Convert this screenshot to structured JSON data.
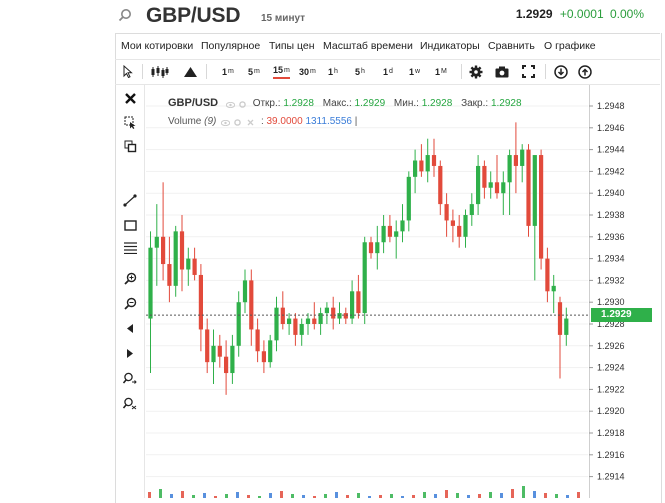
{
  "header": {
    "symbol": "GBP/USD",
    "timeframe": "15 минут",
    "price": "1.2929",
    "change": "+0.0001",
    "change_pct": "0.00%"
  },
  "menu": [
    "Мои котировки",
    "Популярное",
    "Типы цен",
    "Масштаб времени",
    "Индикаторы",
    "Сравнить",
    "О графике"
  ],
  "toolbar": {
    "timeframes": [
      {
        "n": "1",
        "u": "m"
      },
      {
        "n": "5",
        "u": "m"
      },
      {
        "n": "15",
        "u": "m"
      },
      {
        "n": "30",
        "u": "m"
      },
      {
        "n": "1",
        "u": "h"
      },
      {
        "n": "5",
        "u": "h"
      },
      {
        "n": "1",
        "u": "d"
      },
      {
        "n": "1",
        "u": "w"
      },
      {
        "n": "1",
        "u": "M"
      }
    ],
    "active_index": 2
  },
  "legend": {
    "symbol": "GBP/USD",
    "open_label": "Откр.:",
    "open": "1.2928",
    "high_label": "Макс.:",
    "high": "1.2929",
    "low_label": "Мин.:",
    "low": "1.2928",
    "close_label": "Закр.:",
    "close": "1.2928",
    "volume_label": "Volume",
    "volume_param": "(9)",
    "volume_v1": "39.0000",
    "volume_v2": "1311.5556"
  },
  "colors": {
    "up": "#2fb04a",
    "down": "#e24a3b",
    "accent": "#e24a3b",
    "volume": "#3b7dd8"
  },
  "chart_data": {
    "type": "candlestick",
    "y_ticks": [
      "1.2948",
      "1.2946",
      "1.2944",
      "1.2942",
      "1.2940",
      "1.2938",
      "1.2936",
      "1.2934",
      "1.2932",
      "1.2930",
      "1.2928",
      "1.2926",
      "1.2924",
      "1.2922",
      "1.2920",
      "1.2918",
      "1.2916",
      "1.2914"
    ],
    "ylim": [
      1.2913,
      1.2949
    ],
    "last_price": "1.2929",
    "candles": [
      {
        "o": 1.29285,
        "h": 1.29365,
        "l": 1.29235,
        "c": 1.2935
      },
      {
        "o": 1.2935,
        "h": 1.2939,
        "l": 1.29315,
        "c": 1.2936
      },
      {
        "o": 1.2936,
        "h": 1.2941,
        "l": 1.2932,
        "c": 1.29335
      },
      {
        "o": 1.29335,
        "h": 1.2936,
        "l": 1.293,
        "c": 1.29315
      },
      {
        "o": 1.29315,
        "h": 1.2937,
        "l": 1.29305,
        "c": 1.29365
      },
      {
        "o": 1.29365,
        "h": 1.2938,
        "l": 1.2931,
        "c": 1.2933
      },
      {
        "o": 1.2933,
        "h": 1.2935,
        "l": 1.29315,
        "c": 1.2934
      },
      {
        "o": 1.2934,
        "h": 1.2935,
        "l": 1.2932,
        "c": 1.29325
      },
      {
        "o": 1.29325,
        "h": 1.29335,
        "l": 1.29255,
        "c": 1.29275
      },
      {
        "o": 1.29275,
        "h": 1.29285,
        "l": 1.29235,
        "c": 1.29245
      },
      {
        "o": 1.29245,
        "h": 1.29275,
        "l": 1.29225,
        "c": 1.2926
      },
      {
        "o": 1.2926,
        "h": 1.2927,
        "l": 1.2924,
        "c": 1.2925
      },
      {
        "o": 1.2925,
        "h": 1.29265,
        "l": 1.29215,
        "c": 1.29235
      },
      {
        "o": 1.29235,
        "h": 1.2927,
        "l": 1.29225,
        "c": 1.2926
      },
      {
        "o": 1.2926,
        "h": 1.2931,
        "l": 1.2925,
        "c": 1.293
      },
      {
        "o": 1.293,
        "h": 1.2933,
        "l": 1.2929,
        "c": 1.2932
      },
      {
        "o": 1.2932,
        "h": 1.2933,
        "l": 1.2926,
        "c": 1.29275
      },
      {
        "o": 1.29275,
        "h": 1.29285,
        "l": 1.29245,
        "c": 1.29255
      },
      {
        "o": 1.29255,
        "h": 1.29265,
        "l": 1.29235,
        "c": 1.29245
      },
      {
        "o": 1.29245,
        "h": 1.2927,
        "l": 1.2924,
        "c": 1.29265
      },
      {
        "o": 1.29265,
        "h": 1.29305,
        "l": 1.29255,
        "c": 1.29295
      },
      {
        "o": 1.29295,
        "h": 1.2931,
        "l": 1.29275,
        "c": 1.2928
      },
      {
        "o": 1.2928,
        "h": 1.2929,
        "l": 1.2927,
        "c": 1.29285
      },
      {
        "o": 1.29285,
        "h": 1.2929,
        "l": 1.2926,
        "c": 1.2927
      },
      {
        "o": 1.2927,
        "h": 1.29285,
        "l": 1.2926,
        "c": 1.2928
      },
      {
        "o": 1.2928,
        "h": 1.2929,
        "l": 1.2927,
        "c": 1.29285
      },
      {
        "o": 1.29285,
        "h": 1.293,
        "l": 1.29275,
        "c": 1.2928
      },
      {
        "o": 1.2928,
        "h": 1.29295,
        "l": 1.2927,
        "c": 1.2929
      },
      {
        "o": 1.2929,
        "h": 1.293,
        "l": 1.2928,
        "c": 1.29295
      },
      {
        "o": 1.29295,
        "h": 1.29305,
        "l": 1.29275,
        "c": 1.29285
      },
      {
        "o": 1.29285,
        "h": 1.293,
        "l": 1.2928,
        "c": 1.2929
      },
      {
        "o": 1.2929,
        "h": 1.29295,
        "l": 1.2928,
        "c": 1.29285
      },
      {
        "o": 1.29285,
        "h": 1.2932,
        "l": 1.2928,
        "c": 1.2931
      },
      {
        "o": 1.2931,
        "h": 1.29325,
        "l": 1.29285,
        "c": 1.2929
      },
      {
        "o": 1.2929,
        "h": 1.2936,
        "l": 1.2928,
        "c": 1.29355
      },
      {
        "o": 1.29355,
        "h": 1.2936,
        "l": 1.2934,
        "c": 1.29345
      },
      {
        "o": 1.29345,
        "h": 1.2937,
        "l": 1.2933,
        "c": 1.29355
      },
      {
        "o": 1.29355,
        "h": 1.2938,
        "l": 1.29345,
        "c": 1.2937
      },
      {
        "o": 1.2937,
        "h": 1.2938,
        "l": 1.29355,
        "c": 1.2936
      },
      {
        "o": 1.2936,
        "h": 1.29375,
        "l": 1.2934,
        "c": 1.29365
      },
      {
        "o": 1.29365,
        "h": 1.2939,
        "l": 1.29355,
        "c": 1.29375
      },
      {
        "o": 1.29375,
        "h": 1.2942,
        "l": 1.29365,
        "c": 1.29415
      },
      {
        "o": 1.29415,
        "h": 1.2944,
        "l": 1.294,
        "c": 1.2943
      },
      {
        "o": 1.2943,
        "h": 1.29445,
        "l": 1.29415,
        "c": 1.2942
      },
      {
        "o": 1.2942,
        "h": 1.2945,
        "l": 1.2941,
        "c": 1.29435
      },
      {
        "o": 1.29435,
        "h": 1.2945,
        "l": 1.29415,
        "c": 1.29425
      },
      {
        "o": 1.29425,
        "h": 1.2943,
        "l": 1.2938,
        "c": 1.2939
      },
      {
        "o": 1.2939,
        "h": 1.294,
        "l": 1.2936,
        "c": 1.29375
      },
      {
        "o": 1.29375,
        "h": 1.29385,
        "l": 1.29355,
        "c": 1.2937
      },
      {
        "o": 1.2937,
        "h": 1.2938,
        "l": 1.2935,
        "c": 1.2936
      },
      {
        "o": 1.2936,
        "h": 1.29385,
        "l": 1.2935,
        "c": 1.2938
      },
      {
        "o": 1.2938,
        "h": 1.294,
        "l": 1.2937,
        "c": 1.2939
      },
      {
        "o": 1.2939,
        "h": 1.29435,
        "l": 1.2938,
        "c": 1.29425
      },
      {
        "o": 1.29425,
        "h": 1.2943,
        "l": 1.29395,
        "c": 1.29405
      },
      {
        "o": 1.29405,
        "h": 1.2942,
        "l": 1.29395,
        "c": 1.2941
      },
      {
        "o": 1.2941,
        "h": 1.29435,
        "l": 1.29395,
        "c": 1.294
      },
      {
        "o": 1.294,
        "h": 1.2942,
        "l": 1.2938,
        "c": 1.2941
      },
      {
        "o": 1.2941,
        "h": 1.2944,
        "l": 1.2938,
        "c": 1.29435
      },
      {
        "o": 1.29435,
        "h": 1.29465,
        "l": 1.294,
        "c": 1.29425
      },
      {
        "o": 1.29425,
        "h": 1.29445,
        "l": 1.2941,
        "c": 1.2944
      },
      {
        "o": 1.2944,
        "h": 1.29445,
        "l": 1.2936,
        "c": 1.2937
      },
      {
        "o": 1.2937,
        "h": 1.2939,
        "l": 1.2932,
        "c": 1.29435
      },
      {
        "o": 1.29435,
        "h": 1.2944,
        "l": 1.2933,
        "c": 1.2934
      },
      {
        "o": 1.2934,
        "h": 1.2935,
        "l": 1.293,
        "c": 1.2931
      },
      {
        "o": 1.2931,
        "h": 1.29325,
        "l": 1.2929,
        "c": 1.29315
      },
      {
        "o": 1.293,
        "h": 1.29305,
        "l": 1.2923,
        "c": 1.2927
      },
      {
        "o": 1.2927,
        "h": 1.29295,
        "l": 1.2926,
        "c": 1.29285
      }
    ]
  }
}
